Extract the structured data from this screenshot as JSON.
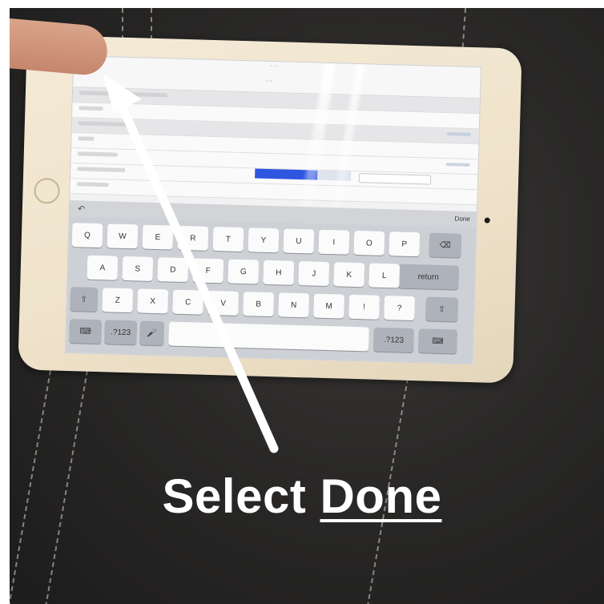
{
  "caption": {
    "prefix": "Select",
    "emphasis": "Done"
  },
  "keyboard": {
    "done_key": "Done",
    "return_key": "return",
    "numbers_key": ".?123",
    "rows": [
      [
        "Q",
        "W",
        "E",
        "R",
        "T",
        "Y",
        "U",
        "I",
        "O",
        "P"
      ],
      [
        "A",
        "S",
        "D",
        "F",
        "G",
        "H",
        "J",
        "K",
        "L"
      ],
      [
        "Z",
        "X",
        "C",
        "V",
        "B",
        "N",
        "M",
        "!",
        "?"
      ]
    ]
  },
  "screen": {
    "progress_fraction": 0.65,
    "progress_color": "#2f56e0"
  },
  "colors": {
    "arrow": "#ffffff",
    "caption": "#ffffff",
    "ipad_bezel": "#f1e6d0",
    "background": "#2a2928"
  },
  "icons": {
    "arrow": "arrow-up-left-icon",
    "finger": "pointing-finger",
    "undo": "undo-icon"
  }
}
